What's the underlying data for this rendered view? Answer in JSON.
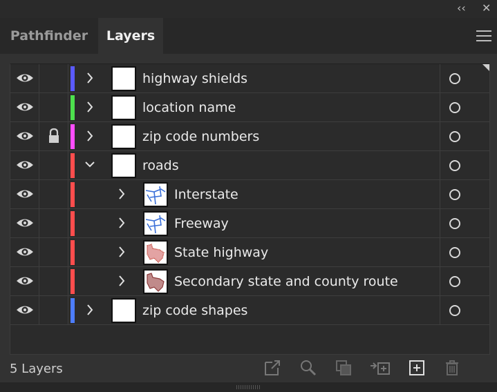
{
  "window": {
    "collapse_glyph": "‹‹",
    "close_glyph": "✕"
  },
  "tabs": [
    {
      "label": "Pathfinder",
      "active": false
    },
    {
      "label": "Layers",
      "active": true
    }
  ],
  "layers": [
    {
      "name": "highway shields",
      "color": "#5a5aff",
      "indent": 0,
      "expanded": false,
      "locked": false,
      "thumb": "blank"
    },
    {
      "name": "location name",
      "color": "#4de04d",
      "indent": 0,
      "expanded": false,
      "locked": false,
      "thumb": "blank"
    },
    {
      "name": "zip code numbers",
      "color": "#ff4dff",
      "indent": 0,
      "expanded": false,
      "locked": true,
      "thumb": "blank"
    },
    {
      "name": "roads",
      "color": "#ff4d4d",
      "indent": 0,
      "expanded": true,
      "locked": false,
      "thumb": "blank"
    },
    {
      "name": "Interstate",
      "color": "#ff4d4d",
      "indent": 1,
      "expanded": false,
      "locked": false,
      "thumb": "blue-lines"
    },
    {
      "name": "Freeway",
      "color": "#ff4d4d",
      "indent": 1,
      "expanded": false,
      "locked": false,
      "thumb": "blue-lines"
    },
    {
      "name": "State highway",
      "color": "#ff4d4d",
      "indent": 1,
      "expanded": false,
      "locked": false,
      "thumb": "red-map"
    },
    {
      "name": "Secondary state and county route",
      "color": "#ff4d4d",
      "indent": 1,
      "expanded": false,
      "locked": false,
      "thumb": "brown-map"
    },
    {
      "name": "zip code shapes",
      "color": "#4d7dff",
      "indent": 0,
      "expanded": false,
      "locked": false,
      "thumb": "blank"
    }
  ],
  "footer": {
    "count_label": "5 Layers"
  }
}
